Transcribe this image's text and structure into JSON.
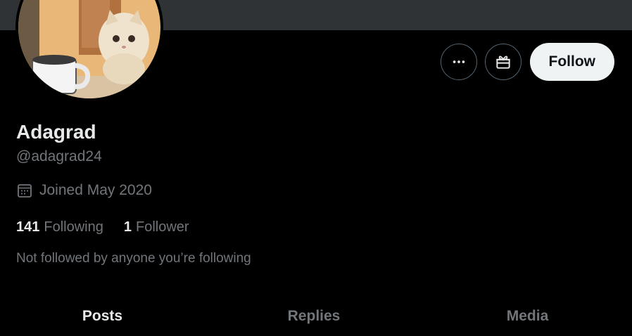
{
  "profile": {
    "display_name": "Adagrad",
    "handle": "@adagrad24",
    "avatar_icon": "kitten-with-mug-avatar",
    "joined": "Joined May 2020",
    "following_count": "141",
    "following_label": "Following",
    "followers_count": "1",
    "followers_label": "Follower",
    "not_followed_text": "Not followed by anyone you’re following"
  },
  "actions": {
    "more_icon": "more-horizontal-icon",
    "gift_icon": "gift-icon",
    "follow_label": "Follow"
  },
  "tabs": [
    {
      "label": "Posts",
      "active": true
    },
    {
      "label": "Replies",
      "active": false
    },
    {
      "label": "Media",
      "active": false
    }
  ],
  "colors": {
    "background": "#000000",
    "banner": "#2f3336",
    "primary_text": "#e7e9ea",
    "secondary_text": "#71767b",
    "follow_button_bg": "#eff3f4"
  }
}
